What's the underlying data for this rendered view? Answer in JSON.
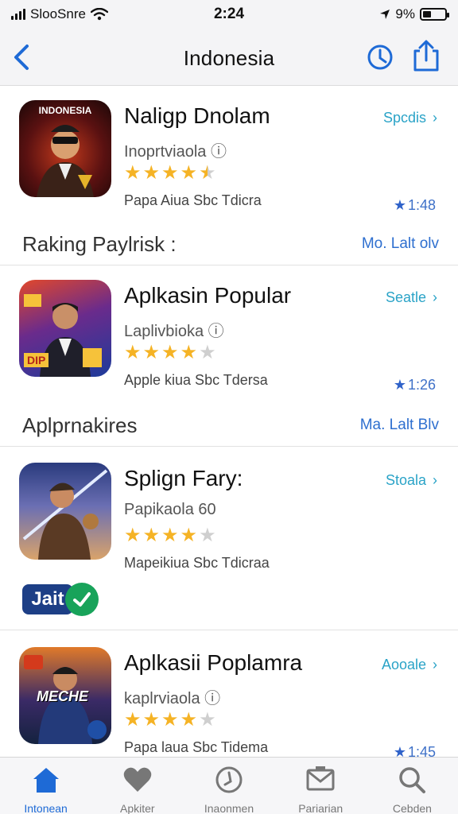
{
  "status_bar": {
    "carrier": "SlooSnre",
    "time": "2:24",
    "battery": "9%"
  },
  "nav": {
    "title": "Indonesia"
  },
  "apps": [
    {
      "name": "Naligp Dnolam",
      "subtitle": "Inoprtviaola ⓘ",
      "rating": 4.5,
      "developer": "Papa Aiua Sbc Tdicra",
      "action": "Spcdis",
      "time": "1:48",
      "icon_text": "INDONESIA"
    },
    {
      "name": "Aplkasin Popular",
      "subtitle": "Laplivbioka ⓘ",
      "rating": 4,
      "developer": "Apple kiua Sbc Tdersa",
      "action": "Seatle",
      "time": "1:26",
      "icon_text": "DIP"
    },
    {
      "name": "Splign Fary:",
      "subtitle": "Papikaola 60",
      "rating": 4,
      "developer": "Mapeikiua Sbc Tdicraa",
      "action": "Stoala",
      "time": "",
      "icon_text": ""
    },
    {
      "name": "Aplkasii Poplamra",
      "subtitle": "kaplrviaola ⓘ",
      "rating": 4,
      "developer": "Papa laua Sbc Tidema",
      "action": "Aooale",
      "time": "1:45",
      "icon_text": "MECHE"
    }
  ],
  "sections": [
    {
      "title": "Raking Paylrisk :",
      "more": "Mo. Lalt olv"
    },
    {
      "title": "Aplprnakires",
      "more": "Ma. Lalt Blv"
    }
  ],
  "badge": {
    "text": "Jait"
  },
  "tabs": [
    {
      "label": "Intonean",
      "icon": "home-icon",
      "active": true
    },
    {
      "label": "Apkiter",
      "icon": "heart-icon",
      "active": false
    },
    {
      "label": "Inaonmen",
      "icon": "clock-icon",
      "active": false
    },
    {
      "label": "Pariarian",
      "icon": "mail-icon",
      "active": false
    },
    {
      "label": "Cebden",
      "icon": "search-icon",
      "active": false
    }
  ],
  "colors": {
    "accent": "#1e6ad6",
    "action": "#2aa3c7",
    "star": "#f5b325"
  }
}
